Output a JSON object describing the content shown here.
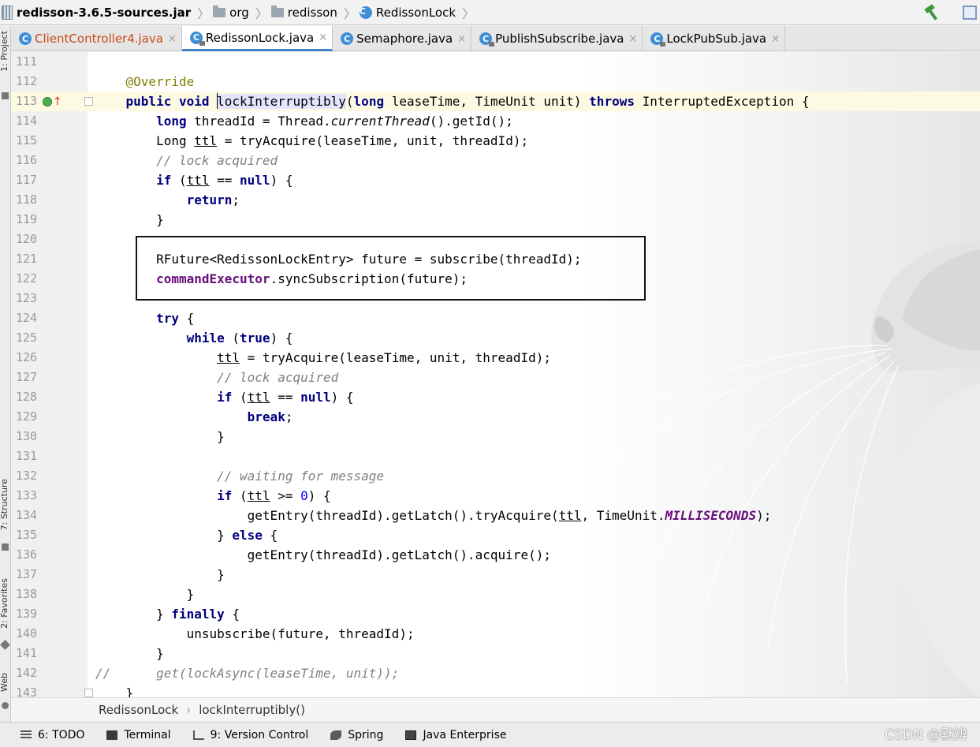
{
  "breadcrumbs": [
    {
      "label": "redisson-3.6.5-sources.jar",
      "icon": "jar-icon"
    },
    {
      "label": "org",
      "icon": "folder-icon"
    },
    {
      "label": "redisson",
      "icon": "folder-icon"
    },
    {
      "label": "RedissonLock",
      "icon": "class-icon"
    }
  ],
  "tabs": [
    {
      "label": "ClientController4.java",
      "active": false,
      "modified": true
    },
    {
      "label": "RedissonLock.java",
      "active": true,
      "modified": false
    },
    {
      "label": "Semaphore.java",
      "active": false,
      "modified": false
    },
    {
      "label": "PublishSubscribe.java",
      "active": false,
      "modified": false
    },
    {
      "label": "LockPubSub.java",
      "active": false,
      "modified": false
    }
  ],
  "tab_close_glyph": "×",
  "class_icon_letter": "C",
  "left_tool_windows": [
    "1: Project",
    "7: Structure",
    "2: Favorites",
    "Web"
  ],
  "editor": {
    "current_line": 113,
    "lines": [
      {
        "n": 111,
        "tokens": []
      },
      {
        "n": 112,
        "tokens": [
          {
            "t": "    "
          },
          {
            "t": "@Override",
            "c": "ann"
          }
        ]
      },
      {
        "n": 113,
        "tokens": [
          {
            "t": "    "
          },
          {
            "t": "public",
            "c": "kw"
          },
          {
            "t": " "
          },
          {
            "t": "void",
            "c": "kw"
          },
          {
            "t": " "
          },
          {
            "t": "lockInterruptibly",
            "c": "hl"
          },
          {
            "t": "("
          },
          {
            "t": "long",
            "c": "kw"
          },
          {
            "t": " leaseTime, TimeUnit unit) "
          },
          {
            "t": "throws",
            "c": "kw"
          },
          {
            "t": " InterruptedException {"
          }
        ]
      },
      {
        "n": 114,
        "tokens": [
          {
            "t": "        "
          },
          {
            "t": "long",
            "c": "kw"
          },
          {
            "t": " threadId = Thread."
          },
          {
            "t": "currentThread",
            "c": "it"
          },
          {
            "t": "().getId();"
          }
        ]
      },
      {
        "n": 115,
        "tokens": [
          {
            "t": "        Long "
          },
          {
            "t": "ttl",
            "c": "ul"
          },
          {
            "t": " = tryAcquire(leaseTime, unit, threadId);"
          }
        ]
      },
      {
        "n": 116,
        "tokens": [
          {
            "t": "        "
          },
          {
            "t": "// lock acquired",
            "c": "cmt"
          }
        ]
      },
      {
        "n": 117,
        "tokens": [
          {
            "t": "        "
          },
          {
            "t": "if",
            "c": "kw"
          },
          {
            "t": " ("
          },
          {
            "t": "ttl",
            "c": "ul"
          },
          {
            "t": " == "
          },
          {
            "t": "null",
            "c": "kw"
          },
          {
            "t": ") {"
          }
        ]
      },
      {
        "n": 118,
        "tokens": [
          {
            "t": "            "
          },
          {
            "t": "return",
            "c": "kw"
          },
          {
            "t": ";"
          }
        ]
      },
      {
        "n": 119,
        "tokens": [
          {
            "t": "        }"
          }
        ]
      },
      {
        "n": 120,
        "tokens": []
      },
      {
        "n": 121,
        "tokens": [
          {
            "t": "        RFuture<RedissonLockEntry> future = subscribe(threadId);"
          }
        ]
      },
      {
        "n": 122,
        "tokens": [
          {
            "t": "        "
          },
          {
            "t": "commandExecutor",
            "c": "fld"
          },
          {
            "t": ".syncSubscription(future);"
          }
        ]
      },
      {
        "n": 123,
        "tokens": []
      },
      {
        "n": 124,
        "tokens": [
          {
            "t": "        "
          },
          {
            "t": "try",
            "c": "kw"
          },
          {
            "t": " {"
          }
        ]
      },
      {
        "n": 125,
        "tokens": [
          {
            "t": "            "
          },
          {
            "t": "while",
            "c": "kw"
          },
          {
            "t": " ("
          },
          {
            "t": "true",
            "c": "kw"
          },
          {
            "t": ") {"
          }
        ]
      },
      {
        "n": 126,
        "tokens": [
          {
            "t": "                "
          },
          {
            "t": "ttl",
            "c": "ul"
          },
          {
            "t": " = tryAcquire(leaseTime, unit, threadId);"
          }
        ]
      },
      {
        "n": 127,
        "tokens": [
          {
            "t": "                "
          },
          {
            "t": "// lock acquired",
            "c": "cmt"
          }
        ]
      },
      {
        "n": 128,
        "tokens": [
          {
            "t": "                "
          },
          {
            "t": "if",
            "c": "kw"
          },
          {
            "t": " ("
          },
          {
            "t": "ttl",
            "c": "ul"
          },
          {
            "t": " == "
          },
          {
            "t": "null",
            "c": "kw"
          },
          {
            "t": ") {"
          }
        ]
      },
      {
        "n": 129,
        "tokens": [
          {
            "t": "                    "
          },
          {
            "t": "break",
            "c": "kw"
          },
          {
            "t": ";"
          }
        ]
      },
      {
        "n": 130,
        "tokens": [
          {
            "t": "                }"
          }
        ]
      },
      {
        "n": 131,
        "tokens": []
      },
      {
        "n": 132,
        "tokens": [
          {
            "t": "                "
          },
          {
            "t": "// waiting for message",
            "c": "cmt"
          }
        ]
      },
      {
        "n": 133,
        "tokens": [
          {
            "t": "                "
          },
          {
            "t": "if",
            "c": "kw"
          },
          {
            "t": " ("
          },
          {
            "t": "ttl",
            "c": "ul"
          },
          {
            "t": " >= "
          },
          {
            "t": "0",
            "c": "num"
          },
          {
            "t": ") {"
          }
        ]
      },
      {
        "n": 134,
        "tokens": [
          {
            "t": "                    getEntry(threadId).getLatch().tryAcquire("
          },
          {
            "t": "ttl",
            "c": "ul"
          },
          {
            "t": ", TimeUnit."
          },
          {
            "t": "MILLISECONDS",
            "c": "sfld"
          },
          {
            "t": ");"
          }
        ]
      },
      {
        "n": 135,
        "tokens": [
          {
            "t": "                } "
          },
          {
            "t": "else",
            "c": "kw"
          },
          {
            "t": " {"
          }
        ]
      },
      {
        "n": 136,
        "tokens": [
          {
            "t": "                    getEntry(threadId).getLatch().acquire();"
          }
        ]
      },
      {
        "n": 137,
        "tokens": [
          {
            "t": "                }"
          }
        ]
      },
      {
        "n": 138,
        "tokens": [
          {
            "t": "            }"
          }
        ]
      },
      {
        "n": 139,
        "tokens": [
          {
            "t": "        } "
          },
          {
            "t": "finally",
            "c": "kw"
          },
          {
            "t": " {"
          }
        ]
      },
      {
        "n": 140,
        "tokens": [
          {
            "t": "            unsubscribe(future, threadId);"
          }
        ]
      },
      {
        "n": 141,
        "tokens": [
          {
            "t": "        }"
          }
        ]
      },
      {
        "n": 142,
        "tokens": [
          {
            "t": "//      get(lockAsync(leaseTime, unit));",
            "c": "cmt",
            "outdent": true
          }
        ]
      },
      {
        "n": 143,
        "tokens": [
          {
            "t": "    }"
          }
        ]
      }
    ]
  },
  "editor_breadcrumb": [
    "RedissonLock",
    "lockInterruptibly()"
  ],
  "bottom_tools": [
    {
      "label": "6: TODO",
      "icon": "todo-icon"
    },
    {
      "label": "Terminal",
      "icon": "terminal-icon"
    },
    {
      "label": "9: Version Control",
      "icon": "version-control-icon"
    },
    {
      "label": "Spring",
      "icon": "spring-icon"
    },
    {
      "label": "Java Enterprise",
      "icon": "java-enterprise-icon"
    }
  ],
  "watermark": "CSDN @默辨",
  "colors": {
    "keyword": "#000080",
    "annotation": "#808000",
    "comment": "#808080",
    "number": "#0000ff",
    "field": "#660e7a",
    "current_line": "#fcfae2",
    "active_tab_underline": "#4083c9"
  }
}
